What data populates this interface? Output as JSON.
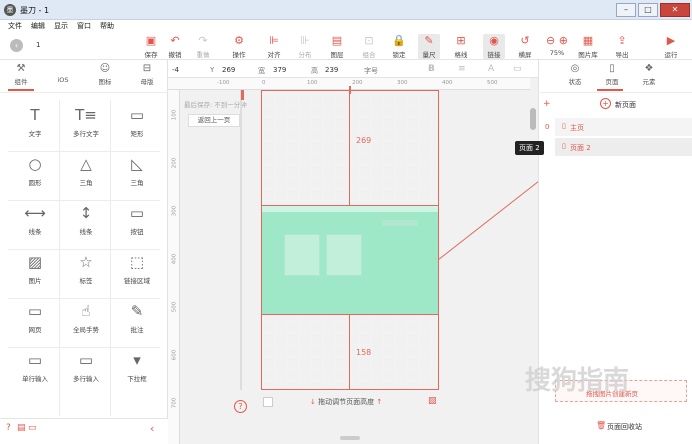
{
  "window": {
    "title": "墨刀 - 1",
    "logo": "墨",
    "minimize": "–",
    "maximize": "□",
    "close": "✕"
  },
  "menu": [
    "文件",
    "编辑",
    "显示",
    "窗口",
    "帮助"
  ],
  "nav": {
    "back_icon": "back-circle-icon",
    "page_number": "1"
  },
  "toolbar": [
    {
      "label": "保存",
      "icon": "save-icon",
      "glyph": "▣",
      "state": "normal"
    },
    {
      "label": "撤销",
      "icon": "undo-icon",
      "glyph": "↶",
      "state": "normal"
    },
    {
      "label": "重做",
      "icon": "redo-icon",
      "glyph": "↷",
      "state": "disabled"
    },
    {
      "label": "操作",
      "icon": "action-icon",
      "glyph": "⚙",
      "state": "normal"
    },
    {
      "label": "对齐",
      "icon": "align-icon",
      "glyph": "⊫",
      "state": "normal"
    },
    {
      "label": "分布",
      "icon": "distribute-icon",
      "glyph": "⊪",
      "state": "disabled"
    },
    {
      "label": "图层",
      "icon": "layer-icon",
      "glyph": "▤",
      "state": "normal"
    },
    {
      "label": "组合",
      "icon": "group-icon",
      "glyph": "⊡",
      "state": "disabled"
    },
    {
      "label": "锁定",
      "icon": "lock-icon",
      "glyph": "🔒",
      "state": "normal"
    },
    {
      "label": "量尺",
      "icon": "ruler-icon",
      "glyph": "✎",
      "state": "active"
    },
    {
      "label": "格线",
      "icon": "grid-icon",
      "glyph": "⊞",
      "state": "normal"
    },
    {
      "label": "链接",
      "icon": "link-eye-icon",
      "glyph": "◉",
      "state": "active"
    },
    {
      "label": "横屏",
      "icon": "rotate-icon",
      "glyph": "↺",
      "state": "normal"
    },
    {
      "label": "75%",
      "icon": "zoom-icon",
      "glyph": "⊖ ⊕",
      "state": "normal"
    },
    {
      "label": "图片库",
      "icon": "image-library-icon",
      "glyph": "▦",
      "state": "normal"
    },
    {
      "label": "导出",
      "icon": "export-icon",
      "glyph": "⇪",
      "state": "normal"
    },
    {
      "label": "运行",
      "icon": "run-icon",
      "glyph": "▶",
      "state": "normal"
    }
  ],
  "left_tabs": [
    {
      "label": "组件",
      "icon": "component-icon",
      "glyph": "⚒"
    },
    {
      "label": "iOS",
      "icon": "apple-icon",
      "glyph": ""
    },
    {
      "label": "图标",
      "icon": "emoji-icon",
      "glyph": "☺"
    },
    {
      "label": "母版",
      "icon": "master-icon",
      "glyph": "⊟"
    }
  ],
  "components": [
    {
      "label": "文字",
      "icon": "text-icon",
      "glyph": "T"
    },
    {
      "label": "多行文字",
      "icon": "multiline-text-icon",
      "glyph": "T≡"
    },
    {
      "label": "矩形",
      "icon": "rectangle-icon",
      "glyph": "▭"
    },
    {
      "label": "圆形",
      "icon": "circle-icon",
      "glyph": "○"
    },
    {
      "label": "三角",
      "icon": "triangle-icon",
      "glyph": "△"
    },
    {
      "label": "三角",
      "icon": "right-triangle-icon",
      "glyph": "◺"
    },
    {
      "label": "线条",
      "icon": "h-line-icon",
      "glyph": "⟷"
    },
    {
      "label": "线条",
      "icon": "v-line-icon",
      "glyph": "↕"
    },
    {
      "label": "按钮",
      "icon": "button-icon",
      "glyph": "▭"
    },
    {
      "label": "图片",
      "icon": "image-icon",
      "glyph": "▨"
    },
    {
      "label": "标签",
      "icon": "tag-star-icon",
      "glyph": "☆"
    },
    {
      "label": "链接区域",
      "icon": "link-area-icon",
      "glyph": "⬚"
    },
    {
      "label": "网页",
      "icon": "webpage-icon",
      "glyph": "▭"
    },
    {
      "label": "全局手势",
      "icon": "gesture-icon",
      "glyph": "☝"
    },
    {
      "label": "批注",
      "icon": "annotation-icon",
      "glyph": "✎"
    },
    {
      "label": "单行输入",
      "icon": "single-input-icon",
      "glyph": "▭"
    },
    {
      "label": "多行输入",
      "icon": "multi-input-icon",
      "glyph": "▭"
    },
    {
      "label": "下拉框",
      "icon": "dropdown-icon",
      "glyph": "▾"
    }
  ],
  "props": {
    "x_label": "X",
    "x_value": "-4",
    "y_label": "Y",
    "y_value": "269",
    "w_label": "宽",
    "w_value": "379",
    "h_label": "高",
    "h_value": "239",
    "font_label": "字号"
  },
  "ruler_h": [
    "-100",
    "0",
    "100",
    "200",
    "300",
    "400",
    "500"
  ],
  "ruler_v": [
    "100",
    "200",
    "300",
    "400",
    "500",
    "600",
    "700"
  ],
  "canvas": {
    "last_saved": "最后保存: 不到一分钟",
    "back_button": "返回上一页",
    "measure_top": "269",
    "measure_bottom": "158",
    "drag_hint": "拖动调节页面高度",
    "help_icon": "help-icon"
  },
  "right_tabs": [
    {
      "label": "状态",
      "icon": "state-icon",
      "glyph": "◎"
    },
    {
      "label": "页面",
      "icon": "page-icon",
      "glyph": "▯"
    },
    {
      "label": "元素",
      "icon": "element-icon",
      "glyph": "❖"
    }
  ],
  "pages": {
    "new_page": "新页面",
    "items": [
      {
        "label": "主页",
        "index": "0"
      },
      {
        "label": "页面 2",
        "index": ""
      }
    ],
    "tooltip": "页面 2",
    "add_from_image": "拖拽图片创建新页",
    "recycle": "页面回收站"
  },
  "watermark": "搜狗指南",
  "colors": {
    "accent": "#e2574c",
    "hotspot": "#9ee8c8",
    "canvas": "#f1f1f1"
  }
}
